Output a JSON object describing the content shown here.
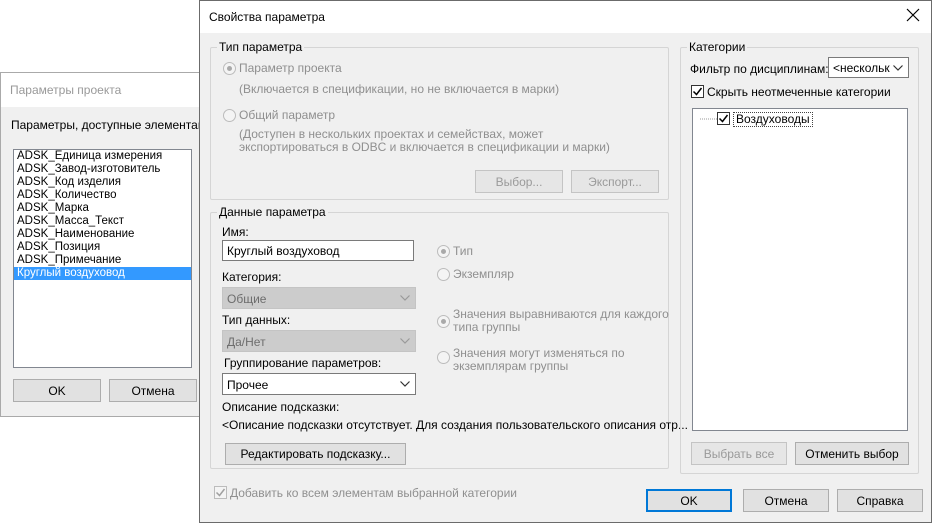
{
  "background_dialog": {
    "title": "Параметры проекта",
    "intro": "Параметры, доступные элементам пр",
    "parameters": [
      "ADSK_Единица измерения",
      "ADSK_Завод-изготовитель",
      "ADSK_Код изделия",
      "ADSK_Количество",
      "ADSK_Марка",
      "ADSK_Масса_Текст",
      "ADSK_Наименование",
      "ADSK_Позиция",
      "ADSK_Примечание",
      "Круглый воздуховод"
    ],
    "ok_label": "OK",
    "cancel_label": "Отмена"
  },
  "dialog": {
    "title": "Свойства параметра",
    "param_type": {
      "group_label": "Тип параметра",
      "project_param_label": "Параметр проекта",
      "project_param_desc": "(Включается в спецификации, но не включается в марки)",
      "shared_param_label": "Общий параметр",
      "shared_param_desc_1": "(Доступен в нескольких проектах и семействах, может",
      "shared_param_desc_2": "экспортироваться в ODBC и включается в спецификации и марки)",
      "select_label": "Выбор...",
      "export_label": "Экспорт..."
    },
    "param_data": {
      "group_label": "Данные параметра",
      "name_label": "Имя:",
      "name_value": "Круглый воздуховод",
      "category_label": "Категория:",
      "category_value": "Общие",
      "datatype_label": "Тип данных:",
      "datatype_value": "Да/Нет",
      "grouping_label": "Группирование параметров:",
      "grouping_value": "Прочее",
      "tooltip_label": "Описание подсказки:",
      "tooltip_value": "<Описание подсказки отсутствует. Для создания пользовательского описания отр...",
      "edit_tooltip_label": "Редактировать подсказку...",
      "type_label": "Тип",
      "instance_label": "Экземпляр",
      "align_label_1": "Значения выравниваются для каждого",
      "align_label_2": "типа группы",
      "vary_label_1": "Значения могут изменяться по",
      "vary_label_2": "экземплярам группы"
    },
    "categories": {
      "group_label": "Категории",
      "filter_label": "Фильтр по дисциплинам:",
      "filter_value": "<нескольк",
      "hide_unchecked_label": "Скрыть неотмеченные категории",
      "items": [
        "Воздуховоды"
      ],
      "select_all_label": "Выбрать все",
      "deselect_label": "Отменить выбор"
    },
    "add_all_label": "Добавить ко всем элементам выбранной категории",
    "ok_label": "OK",
    "cancel_label": "Отмена",
    "help_label": "Справка"
  }
}
